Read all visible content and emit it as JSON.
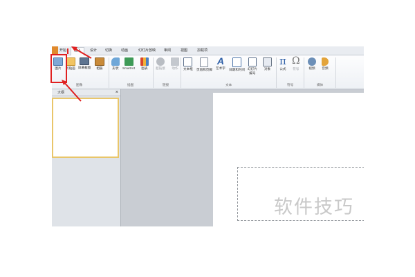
{
  "tabs": {
    "start": "开始",
    "insert": "插入",
    "design": "设计",
    "transitions": "切换",
    "animations": "动画",
    "slideshow": "幻灯片放映",
    "review": "审阅",
    "view": "视图",
    "addins": "加载项"
  },
  "ribbon": {
    "picture": "图片",
    "clipart": "剪贴画",
    "screenshot": "屏幕截图",
    "album": "相册",
    "shapes": "形状",
    "smartart": "SmartArt",
    "chart": "图表",
    "hyperlink": "超链接",
    "action": "动作",
    "textbox": "文本框",
    "header_footer": "页眉和页脚",
    "wordart": "艺术字",
    "datetime": "日期和时间",
    "slide_number_1": "幻灯片",
    "slide_number_2": "编号",
    "object": "对象",
    "equation": "公式",
    "symbol": "符号",
    "video": "视频",
    "audio": "音频"
  },
  "groups": {
    "images": "图像",
    "illustrations": "插图",
    "links": "链接",
    "text": "文本",
    "symbols": "符号",
    "media": "媒体"
  },
  "pane": {
    "outline_tab": "大纲",
    "close": "×"
  },
  "slide": {
    "placeholder_text": "软件技巧"
  },
  "colors": {
    "annotation": "#e02020",
    "file_tab": "#e08a2d",
    "thumb_border": "#e9c66a"
  }
}
